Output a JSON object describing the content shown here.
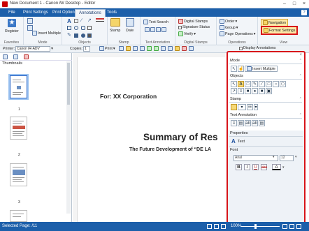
{
  "window": {
    "title": "New Document 1 - Canon iW Desktop - Editor"
  },
  "tabs": [
    {
      "label": "File"
    },
    {
      "label": "Print Settings"
    },
    {
      "label": "Print Option"
    },
    {
      "label": "Annotations"
    },
    {
      "label": "Tools"
    }
  ],
  "ribbon": {
    "favorites": {
      "register": "Register",
      "group": "Favorites"
    },
    "mode": {
      "insert_multiple": "Insert Multiple",
      "group": "Mode"
    },
    "objects": {
      "group": "Objects"
    },
    "stamp": {
      "stamp": "Stamp",
      "date": "Date",
      "group": "Stamp"
    },
    "text_annotation": {
      "text_search": "Text Search",
      "group": "Text Annotation"
    },
    "digital_stamps": {
      "digital_stamps": "Digital Stamps",
      "signature_status": "Signature Status",
      "verify": "Verify",
      "group": "Digital Stamps"
    },
    "operations": {
      "order": "Order",
      "group_op": "Group",
      "page_operations": "Page Operations",
      "group": "Operations"
    },
    "view": {
      "navigation": "Navigation",
      "format_settings": "Format Settings",
      "group": "View"
    }
  },
  "toolbar": {
    "printer_label": "Printer:",
    "printer_value": "Canon iR-ADV",
    "copies_label": "Copies:",
    "copies_value": "1",
    "print": "Print",
    "display_annotations": "Display Annotations"
  },
  "left_panel": {
    "title": "Thumbnails",
    "pages": [
      "1",
      "2",
      "3"
    ]
  },
  "document": {
    "for_line": "For: XX Corporation",
    "summary": "Summary of Res",
    "subtitle": "The Future Development of “DE LA"
  },
  "annotation_panel": {
    "mode": "Mode",
    "insert_multiple": "Insert Multiple",
    "objects": "Objects",
    "stamp": "Stamp",
    "text_annotation": "Text Annotation",
    "properties": "Properties",
    "text_item": "Text",
    "font": "Font",
    "font_name": "Arial",
    "font_size": "12"
  },
  "status": {
    "selected_page": "Selected Page: /11",
    "zoom": "100%"
  },
  "colors": {
    "accent": "#1c5faa",
    "highlight_border": "#d7141a",
    "ribbon_bg": "#f2f5f9"
  }
}
